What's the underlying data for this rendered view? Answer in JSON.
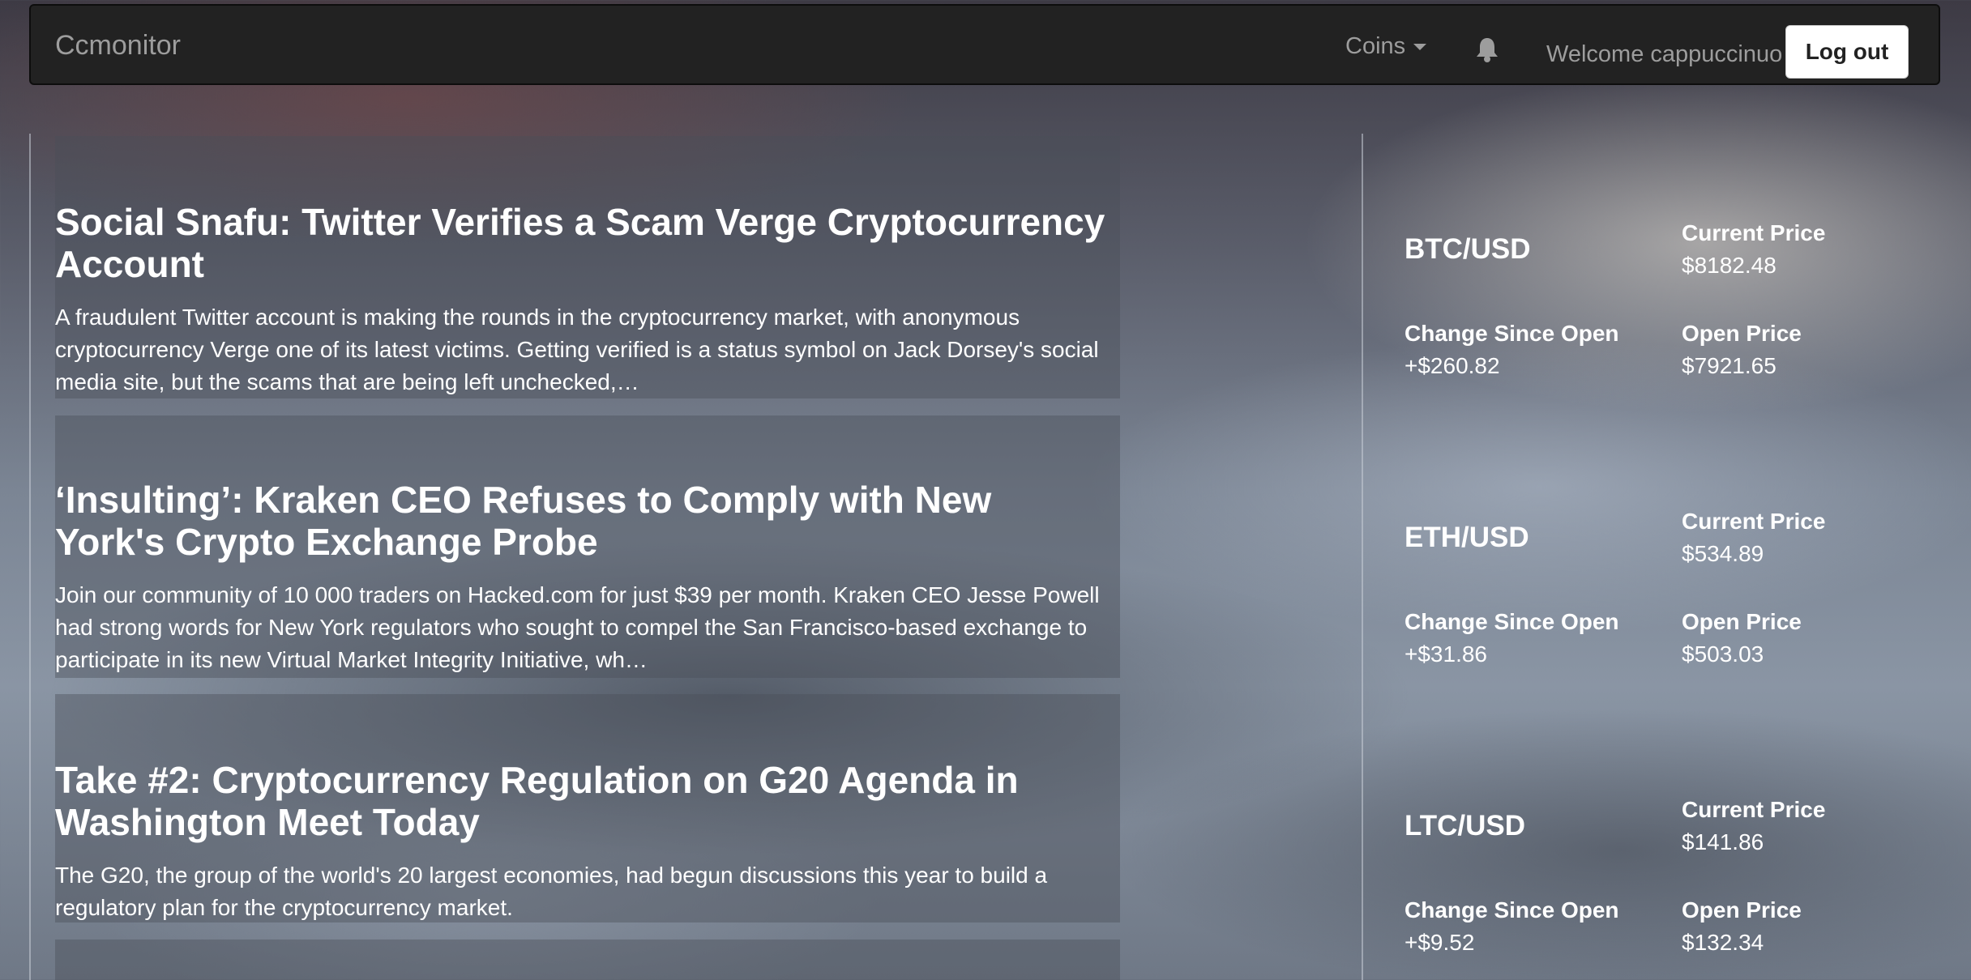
{
  "navbar": {
    "brand": "Ccmonitor",
    "coins_menu": "Coins",
    "welcome": "Welcome cappuccinuo",
    "logout_label": "Log out",
    "colors": {
      "bar": "#222222",
      "text": "#9d9d9d"
    }
  },
  "news": [
    {
      "title": "Social Snafu: Twitter Verifies a Scam Verge Cryptocurrency Account",
      "summary": "A fraudulent Twitter account is making the rounds in the cryptocurrency market, with anonymous cryptocurrency Verge one of its latest victims. Getting verified is a status symbol on Jack Dorsey's social media site, but the scams that are being left unchecked,…"
    },
    {
      "title": "‘Insulting’: Kraken CEO Refuses to Comply with New York's Crypto Exchange Probe",
      "summary": "Join our community of 10 000 traders on Hacked.com for just $39 per month. Kraken CEO Jesse Powell had strong words for New York regulators who sought to compel the San Francisco-based exchange to participate in its new Virtual Market Integrity Initiative, wh…"
    },
    {
      "title": "Take #2: Cryptocurrency Regulation on G20 Agenda in Washington Meet Today",
      "summary": "The G20, the group of the world's 20 largest economies, had begun discussions this year to build a regulatory plan for the cryptocurrency market."
    }
  ],
  "tickers": [
    {
      "pair": "BTC/USD",
      "current_label": "Current Price",
      "current": "$8182.48",
      "change_label": "Change Since Open",
      "change": "+$260.82",
      "open_label": "Open Price",
      "open": "$7921.65"
    },
    {
      "pair": "ETH/USD",
      "current_label": "Current Price",
      "current": "$534.89",
      "change_label": "Change Since Open",
      "change": "+$31.86",
      "open_label": "Open Price",
      "open": "$503.03"
    },
    {
      "pair": "LTC/USD",
      "current_label": "Current Price",
      "current": "$141.86",
      "change_label": "Change Since Open",
      "change": "+$9.52",
      "open_label": "Open Price",
      "open": "$132.34"
    }
  ]
}
